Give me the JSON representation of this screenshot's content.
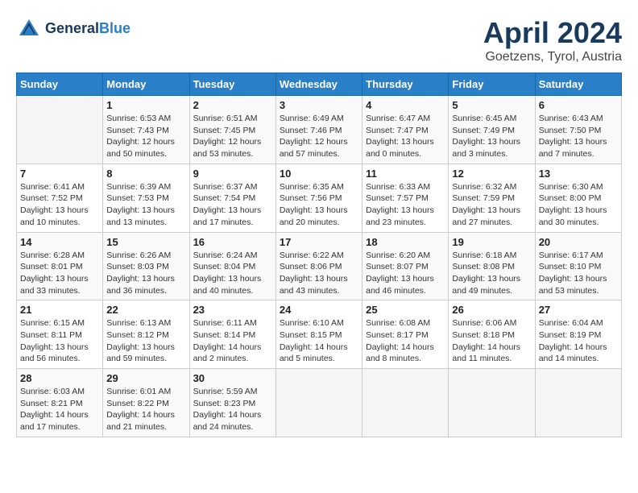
{
  "header": {
    "logo_line1": "General",
    "logo_line2": "Blue",
    "month": "April 2024",
    "location": "Goetzens, Tyrol, Austria"
  },
  "weekdays": [
    "Sunday",
    "Monday",
    "Tuesday",
    "Wednesday",
    "Thursday",
    "Friday",
    "Saturday"
  ],
  "weeks": [
    [
      {
        "day": "",
        "info": ""
      },
      {
        "day": "1",
        "info": "Sunrise: 6:53 AM\nSunset: 7:43 PM\nDaylight: 12 hours\nand 50 minutes."
      },
      {
        "day": "2",
        "info": "Sunrise: 6:51 AM\nSunset: 7:45 PM\nDaylight: 12 hours\nand 53 minutes."
      },
      {
        "day": "3",
        "info": "Sunrise: 6:49 AM\nSunset: 7:46 PM\nDaylight: 12 hours\nand 57 minutes."
      },
      {
        "day": "4",
        "info": "Sunrise: 6:47 AM\nSunset: 7:47 PM\nDaylight: 13 hours\nand 0 minutes."
      },
      {
        "day": "5",
        "info": "Sunrise: 6:45 AM\nSunset: 7:49 PM\nDaylight: 13 hours\nand 3 minutes."
      },
      {
        "day": "6",
        "info": "Sunrise: 6:43 AM\nSunset: 7:50 PM\nDaylight: 13 hours\nand 7 minutes."
      }
    ],
    [
      {
        "day": "7",
        "info": "Sunrise: 6:41 AM\nSunset: 7:52 PM\nDaylight: 13 hours\nand 10 minutes."
      },
      {
        "day": "8",
        "info": "Sunrise: 6:39 AM\nSunset: 7:53 PM\nDaylight: 13 hours\nand 13 minutes."
      },
      {
        "day": "9",
        "info": "Sunrise: 6:37 AM\nSunset: 7:54 PM\nDaylight: 13 hours\nand 17 minutes."
      },
      {
        "day": "10",
        "info": "Sunrise: 6:35 AM\nSunset: 7:56 PM\nDaylight: 13 hours\nand 20 minutes."
      },
      {
        "day": "11",
        "info": "Sunrise: 6:33 AM\nSunset: 7:57 PM\nDaylight: 13 hours\nand 23 minutes."
      },
      {
        "day": "12",
        "info": "Sunrise: 6:32 AM\nSunset: 7:59 PM\nDaylight: 13 hours\nand 27 minutes."
      },
      {
        "day": "13",
        "info": "Sunrise: 6:30 AM\nSunset: 8:00 PM\nDaylight: 13 hours\nand 30 minutes."
      }
    ],
    [
      {
        "day": "14",
        "info": "Sunrise: 6:28 AM\nSunset: 8:01 PM\nDaylight: 13 hours\nand 33 minutes."
      },
      {
        "day": "15",
        "info": "Sunrise: 6:26 AM\nSunset: 8:03 PM\nDaylight: 13 hours\nand 36 minutes."
      },
      {
        "day": "16",
        "info": "Sunrise: 6:24 AM\nSunset: 8:04 PM\nDaylight: 13 hours\nand 40 minutes."
      },
      {
        "day": "17",
        "info": "Sunrise: 6:22 AM\nSunset: 8:06 PM\nDaylight: 13 hours\nand 43 minutes."
      },
      {
        "day": "18",
        "info": "Sunrise: 6:20 AM\nSunset: 8:07 PM\nDaylight: 13 hours\nand 46 minutes."
      },
      {
        "day": "19",
        "info": "Sunrise: 6:18 AM\nSunset: 8:08 PM\nDaylight: 13 hours\nand 49 minutes."
      },
      {
        "day": "20",
        "info": "Sunrise: 6:17 AM\nSunset: 8:10 PM\nDaylight: 13 hours\nand 53 minutes."
      }
    ],
    [
      {
        "day": "21",
        "info": "Sunrise: 6:15 AM\nSunset: 8:11 PM\nDaylight: 13 hours\nand 56 minutes."
      },
      {
        "day": "22",
        "info": "Sunrise: 6:13 AM\nSunset: 8:12 PM\nDaylight: 13 hours\nand 59 minutes."
      },
      {
        "day": "23",
        "info": "Sunrise: 6:11 AM\nSunset: 8:14 PM\nDaylight: 14 hours\nand 2 minutes."
      },
      {
        "day": "24",
        "info": "Sunrise: 6:10 AM\nSunset: 8:15 PM\nDaylight: 14 hours\nand 5 minutes."
      },
      {
        "day": "25",
        "info": "Sunrise: 6:08 AM\nSunset: 8:17 PM\nDaylight: 14 hours\nand 8 minutes."
      },
      {
        "day": "26",
        "info": "Sunrise: 6:06 AM\nSunset: 8:18 PM\nDaylight: 14 hours\nand 11 minutes."
      },
      {
        "day": "27",
        "info": "Sunrise: 6:04 AM\nSunset: 8:19 PM\nDaylight: 14 hours\nand 14 minutes."
      }
    ],
    [
      {
        "day": "28",
        "info": "Sunrise: 6:03 AM\nSunset: 8:21 PM\nDaylight: 14 hours\nand 17 minutes."
      },
      {
        "day": "29",
        "info": "Sunrise: 6:01 AM\nSunset: 8:22 PM\nDaylight: 14 hours\nand 21 minutes."
      },
      {
        "day": "30",
        "info": "Sunrise: 5:59 AM\nSunset: 8:23 PM\nDaylight: 14 hours\nand 24 minutes."
      },
      {
        "day": "",
        "info": ""
      },
      {
        "day": "",
        "info": ""
      },
      {
        "day": "",
        "info": ""
      },
      {
        "day": "",
        "info": ""
      }
    ]
  ]
}
